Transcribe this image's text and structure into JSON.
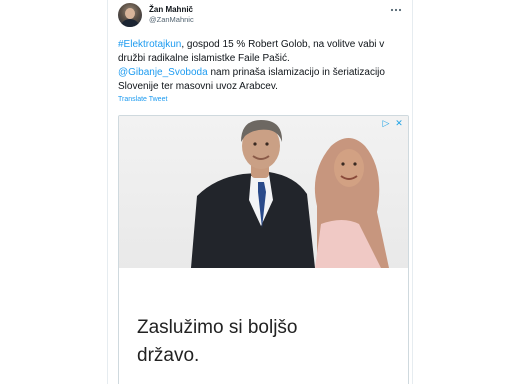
{
  "user": {
    "display_name": "Žan Mahnič",
    "handle": "@ZanMahnic"
  },
  "tweet": {
    "hashtag": "#Elektrotajkun",
    "line1_rest": ", gospod 15 % Robert Golob, na volitve vabi v družbi radikalne islamistke Faile Pašić.",
    "mention": "@Gibanje_Svoboda",
    "line2_rest": " nam prinaša islamizacijo in šeriatizacijo Slovenije ter masovni uvoz Arabcev.",
    "translate_label": "Translate Tweet"
  },
  "ad": {
    "headline_line1": "Zaslužimo si boljšo",
    "headline_line2": "državo.",
    "controls": {
      "adchoices": "▷",
      "close": "✕"
    }
  },
  "icons": {
    "more": "more-horizontal-icon"
  },
  "colors": {
    "link": "#1d9bf0",
    "text": "#0f1419",
    "secondary": "#536471",
    "border": "#cfd9de"
  }
}
